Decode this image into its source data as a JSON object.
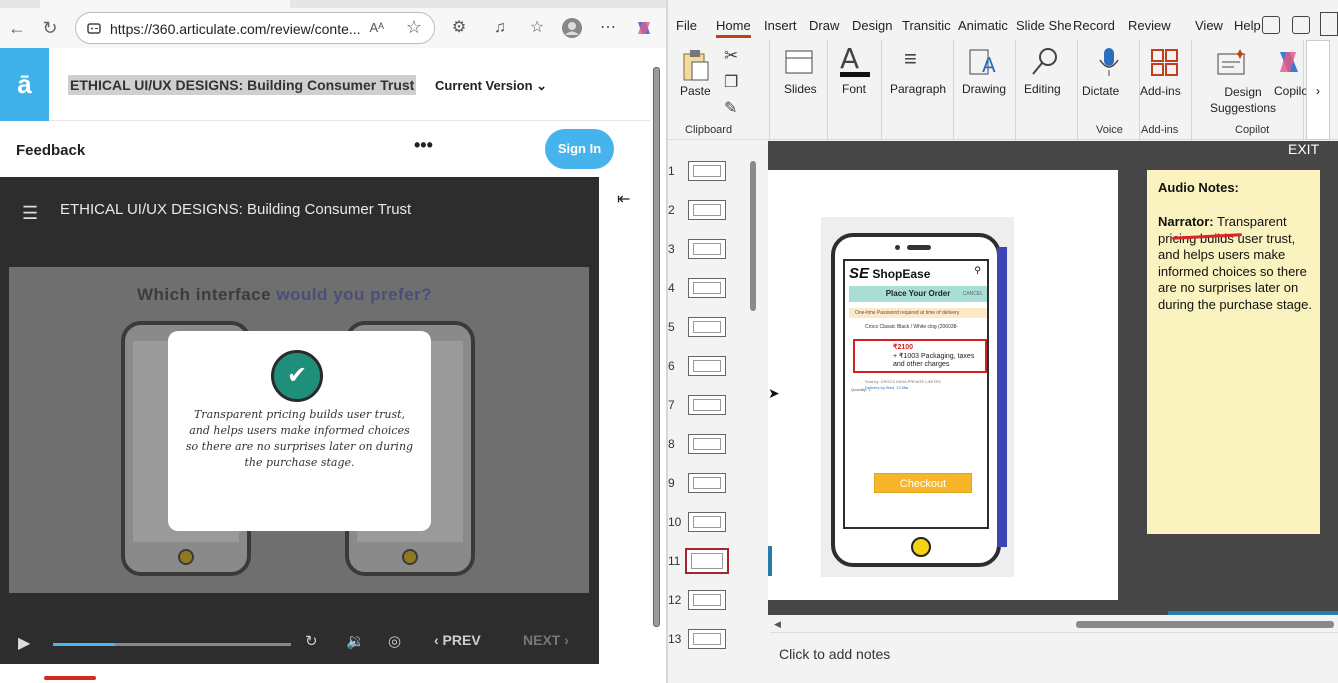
{
  "browser": {
    "url": "https://360.articulate.com/review/conte...",
    "read_aloud": "Aᴬ",
    "back_icon": "←",
    "refresh_icon": "↻",
    "star_icon": "☆",
    "more_icon": "⋯"
  },
  "articulate": {
    "course_title": "ETHICAL UI/UX DESIGNS: Building Consumer Trust",
    "version_label": "Current Version ⌄",
    "feedback_label": "Feedback",
    "more_label": "•••",
    "signin_label": "Sign In",
    "logo_letter": "ā"
  },
  "player": {
    "title": "ETHICAL UI/UX DESIGNS: Building Consumer Trust",
    "question_a": "Which interface ",
    "question_b": "would you prefer?",
    "modal_text": "Transparent pricing builds user trust, and helps users make informed choices so there are no surprises later on during the purchase stage.",
    "check_icon": "✔",
    "prev_label": "‹ PREV",
    "next_label": "NEXT ›",
    "progress_fraction": 0.26,
    "play_icon": "▶",
    "replay_icon": "↻",
    "volume_icon": "🔉",
    "captions_icon": "◎",
    "collapse_icon": "⇤"
  },
  "ppt": {
    "tabs": [
      "File",
      "Home",
      "Insert",
      "Draw",
      "Design",
      "Transitic",
      "Animatic",
      "Slide Shе",
      "Record",
      "Review",
      "View",
      "Help"
    ],
    "active_tab": "Home",
    "groups": {
      "paste": "Paste",
      "clipboard": "Clipboard",
      "slides": "Slides",
      "font": "Font",
      "paragraph": "Paragraph",
      "drawing": "Drawing",
      "editing": "Editing",
      "dictate": "Dictate",
      "voice": "Voice",
      "addins": "Add-ins",
      "addins_group": "Add-ins",
      "design_suggestions": "Design\nSuggestions",
      "copilot": "Copilo",
      "copilot_group": "Copilot"
    },
    "slide_numbers": [
      "1",
      "2",
      "3",
      "4",
      "5",
      "6",
      "7",
      "8",
      "9",
      "10",
      "11",
      "12",
      "13"
    ],
    "selected_slide": 11,
    "exit_label": "EXIT",
    "notes_heading": "Audio Notes:",
    "narrator_label": "Narrator:",
    "narrator_text": " Transparent pricing builds user trust, and helps users make informed choices so there are no surprises later on during the purchase stage.",
    "click_notes": "Click to add notes",
    "shop": {
      "brand_logo": "SE",
      "brand_name": "ShopEase",
      "order_header": "Place Your Order",
      "cancel": "CANCEL",
      "otp_notice": "One-time Password required at time of delivery",
      "product": "Crocs Classic Black / White clog (206038-",
      "price_main": "₹2100",
      "price_extra1": "+ ₹1003 Packaging, taxes",
      "price_extra2": "and other charges",
      "sold_by": "Sold by: CROCS INDIA PRIVATE LIMITED",
      "delivery": "Delivery by Wed, 13 Mar",
      "quantity": "Quantity:  1",
      "checkout": "Checkout"
    }
  },
  "colors": {
    "articulate_blue": "#3fb0e8",
    "ppt_accent": "#c43e1c",
    "notes_bg": "#faf3c0",
    "checkout": "#f7b52a"
  }
}
